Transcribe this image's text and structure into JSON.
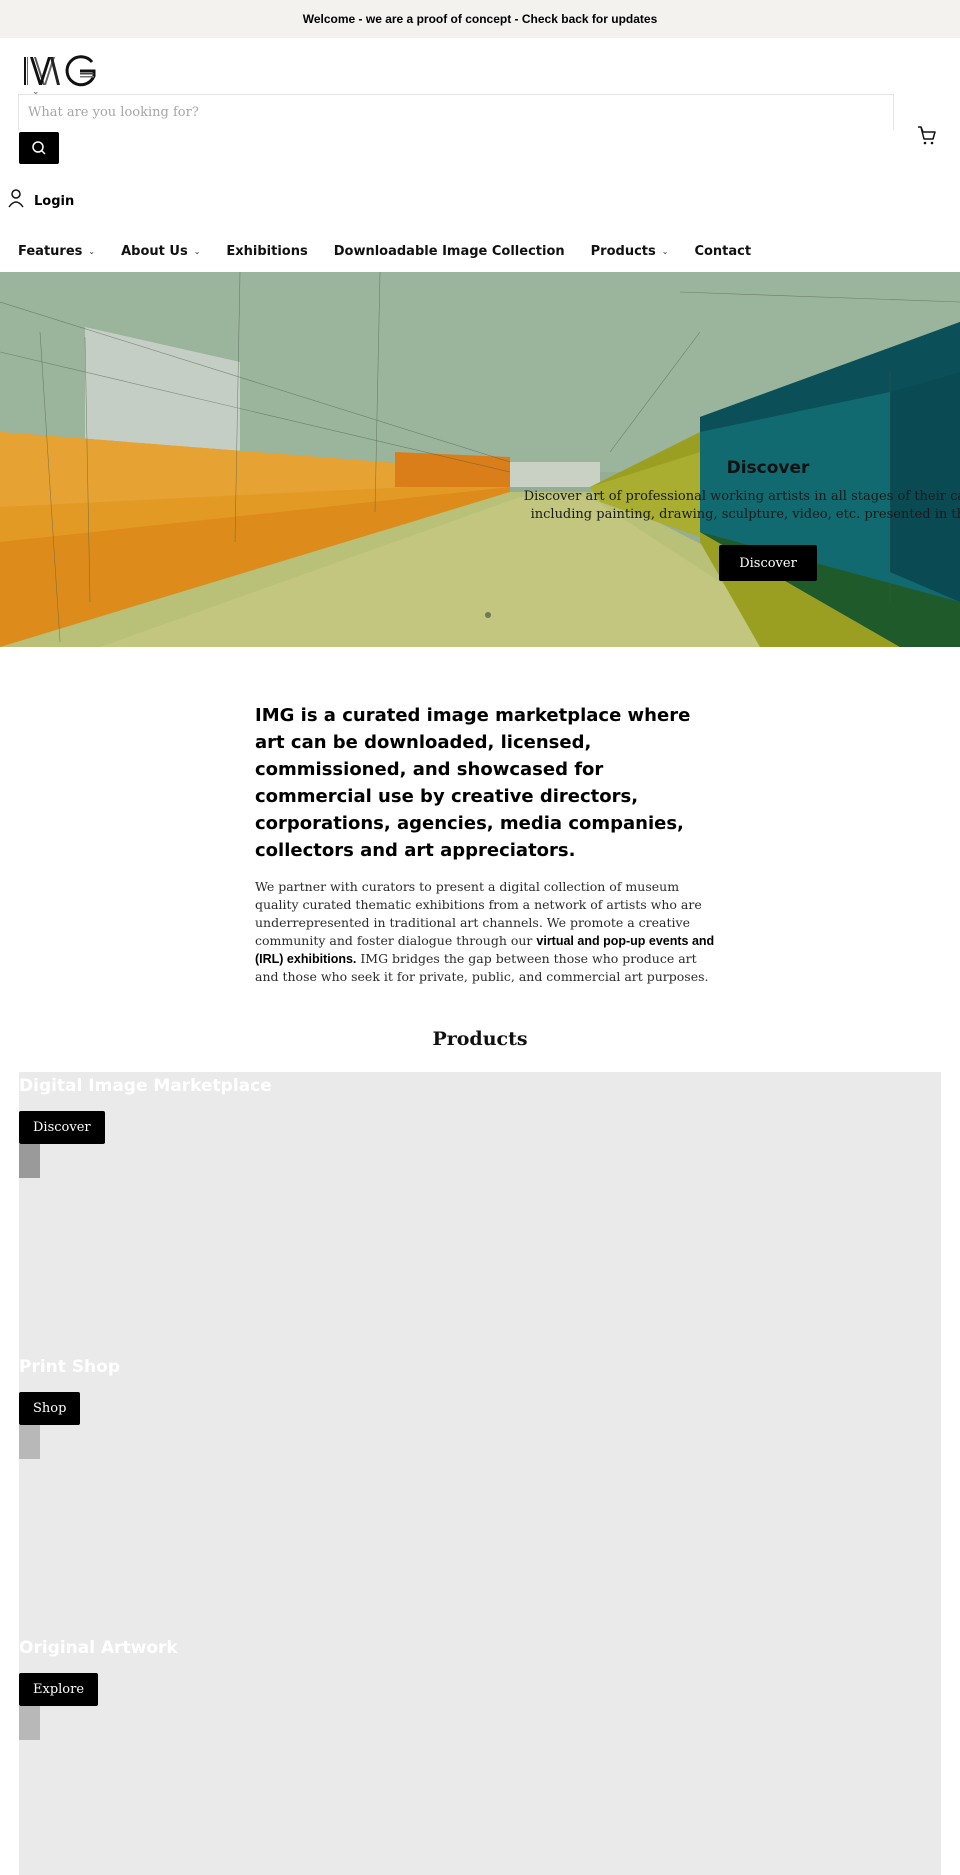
{
  "announcement": {
    "text": "Welcome - we are a proof of concept - Check back for updates"
  },
  "header": {
    "logo_text": "IMG",
    "search": {
      "placeholder": "What are you looking for?",
      "value": ""
    },
    "login_label": "Login",
    "icons": {
      "search": "search-icon",
      "cart": "cart-icon",
      "account": "user-icon"
    }
  },
  "nav": {
    "items": [
      {
        "label": "Features",
        "has_dropdown": true
      },
      {
        "label": "About Us",
        "has_dropdown": true
      },
      {
        "label": "Exhibitions",
        "has_dropdown": false
      },
      {
        "label": "Downloadable Image Collection",
        "has_dropdown": false
      },
      {
        "label": "Products",
        "has_dropdown": true
      },
      {
        "label": "Contact",
        "has_dropdown": false
      }
    ],
    "chevron": "⌄"
  },
  "hero": {
    "title": "Discover",
    "text_line1": "Discover art of professional working artists in all stages of their careers in",
    "text_line2": "including painting, drawing, sculpture, video, etc. presented in thematic",
    "button_label": "Discover",
    "slides": 1,
    "active_slide": 1
  },
  "intro": {
    "heading": "IMG is a curated image marketplace where art can be downloaded, licensed, commissioned, and showcased for commercial use by creative directors, corporations, agencies, media companies, collectors and art appreciators.",
    "body_part1": "We partner with curators to present a digital collection of museum quality curated thematic exhibitions from a network of artists who are underrepresented in traditional art channels. We promote a creative community and foster dialogue through our ",
    "body_bold": "virtual and pop-up events and (IRL) exhibitions.",
    "body_part2": " IMG bridges the gap between those who produce art and those who seek it for private, public, and commercial art purposes."
  },
  "products": {
    "title": "Products",
    "items": [
      {
        "title": "Digital Image Marketplace",
        "button_label": "Discover"
      },
      {
        "title": "Print Shop",
        "button_label": "Shop"
      },
      {
        "title": "Original Artwork",
        "button_label": "Explore"
      }
    ]
  },
  "colors": {
    "announcement_bg": "#f3f2ef",
    "button_bg": "#000000",
    "products_bg": "#eaeaea"
  }
}
